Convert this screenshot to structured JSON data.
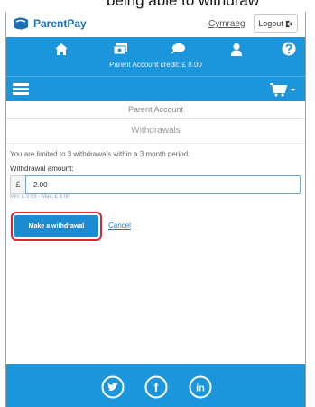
{
  "page_caption": "being able to withdraw",
  "brand": {
    "name": "ParentPay",
    "brand_color": "#1c6fb5",
    "logo_icon": "parentpay-logo-icon"
  },
  "header": {
    "language_link": "Cymraeg",
    "logout_label": "Logout",
    "logout_icon": "logout-arrow-icon"
  },
  "nav": {
    "bar_color": "#1b95dc",
    "icons": [
      "home-icon",
      "payments-icon",
      "messages-icon",
      "profile-icon",
      "help-icon"
    ],
    "credit_text": "Parent Account credit: £ 8.00"
  },
  "toolbar": {
    "menu_icon": "hamburger-menu-icon",
    "cart_icon": "cart-icon"
  },
  "section": {
    "title": "Parent Account",
    "subtitle": "Withdrawals"
  },
  "form": {
    "limit_text": "You are limited to 3 withdrawals within a 3 month period.",
    "amount_label": "Withdrawal amount:",
    "currency_symbol": "£",
    "amount_value": "2.00",
    "min_max_text": "Min: £ 0.05 - Max: £ 8.00",
    "submit_label": "Make a withdrawal",
    "cancel_label": "Cancel",
    "highlight_color": "#e0242f"
  },
  "footer": {
    "social_icons": [
      "twitter-icon",
      "facebook-icon",
      "linkedin-icon"
    ],
    "social_labels": {
      "facebook": "f",
      "linkedin": "in"
    }
  }
}
